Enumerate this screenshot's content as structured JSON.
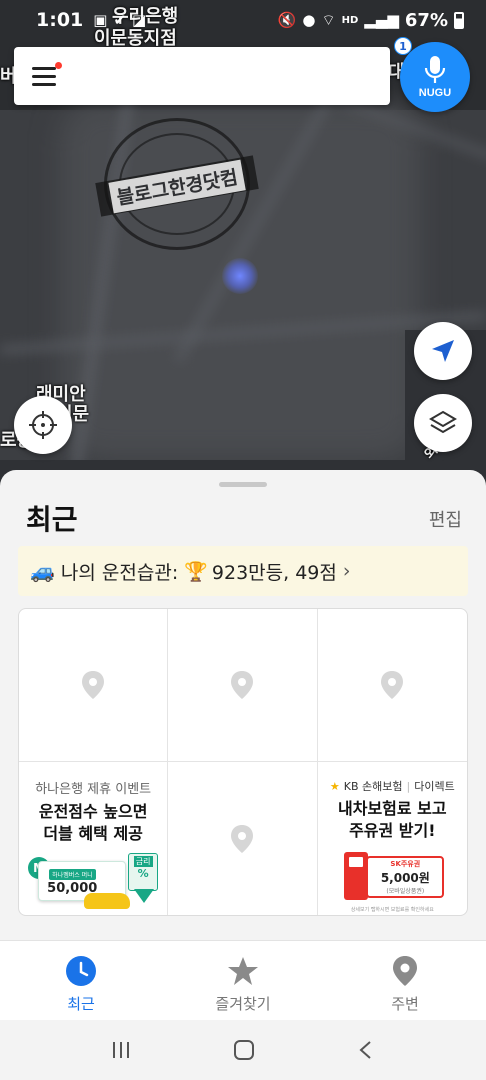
{
  "status_bar": {
    "time": "1:01",
    "battery": "67%",
    "network": "HD"
  },
  "map": {
    "labels": [
      "우리은행",
      "이문동지점",
      "버",
      "대",
      "래미안",
      "이문",
      "로동",
      "외",
      "ㅇ"
    ],
    "stamp_text": "블로그한경닷컴"
  },
  "search": {
    "placeholder": "",
    "menu_has_notification": true
  },
  "nugu": {
    "label": "NUGU",
    "badge": "1"
  },
  "sheet": {
    "title": "최근",
    "edit_label": "편집",
    "habit_prefix": "나의 운전습관:",
    "habit_rank": "923만등, 49점",
    "ads": {
      "hana": {
        "sub": "하나은행 제휴 이벤트",
        "title_line1": "운전점수 높으면",
        "title_line2": "더블 혜택 제공",
        "money_label": "하나멤버스 머니",
        "amount": "50,000",
        "rate_label": "금리",
        "rate_symbol": "%"
      },
      "kb": {
        "brand": "KB 손해보험",
        "tag": "다이렉트",
        "title_line1": "내차보험료 보고",
        "title_line2": "주유권 받기!",
        "coupon_brand": "SK주유권",
        "coupon_amount": "5,000원",
        "coupon_note": "(모바일상품권)",
        "fine_print": "상세보기 탭하시면 보험료를 확인하세요"
      }
    }
  },
  "bottom_nav": {
    "items": [
      {
        "label": "최근",
        "icon": "clock-icon",
        "active": true
      },
      {
        "label": "즐겨찾기",
        "icon": "star-icon",
        "active": false
      },
      {
        "label": "주변",
        "icon": "location-pin-icon",
        "active": false
      }
    ]
  },
  "colors": {
    "accent": "#1a73e8",
    "nugu_blue": "#1d8dfb",
    "habit_bg": "#fbf7e2",
    "map_bg": "#3c3e42"
  }
}
